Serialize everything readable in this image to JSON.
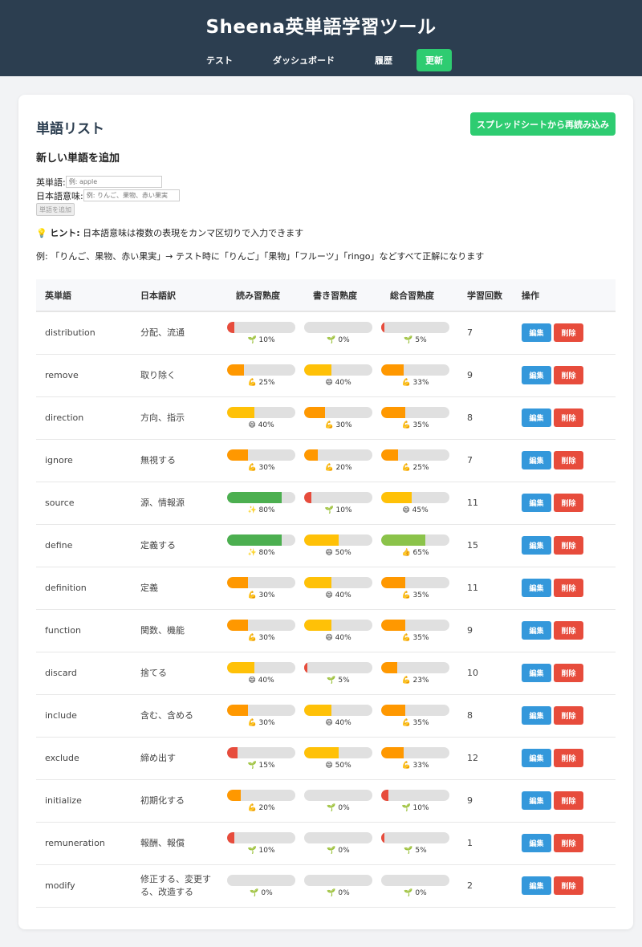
{
  "header": {
    "title": "Sheena英単語学習ツール",
    "nav": [
      {
        "label": "テスト"
      },
      {
        "label": "ダッシュボード"
      },
      {
        "label": "履歴"
      },
      {
        "label": "更新"
      }
    ]
  },
  "main": {
    "title": "単語リスト",
    "reload_label": "スプレッドシートから再読み込み",
    "add_title": "新しい単語を追加",
    "form": {
      "english_label": "英単語:",
      "english_placeholder": "例: apple",
      "japanese_label": "日本語意味:",
      "japanese_placeholder": "例: りんご、果物、赤い果実",
      "submit_label": "単語を追加"
    },
    "hint_icon": "💡",
    "hint_strong": "ヒント:",
    "hint_text": "日本語意味は複数の表現をカンマ区切りで入力できます",
    "example_text": "例: 「りんご、果物、赤い果実」→ テスト時に「りんご」「果物」「フルーツ」「ringo」などすべて正解になります"
  },
  "table": {
    "columns": [
      "英単語",
      "日本語訳",
      "読み習熟度",
      "書き習熟度",
      "総合習熟度",
      "学習回数",
      "操作"
    ],
    "edit_label": "編集",
    "delete_label": "削除",
    "rows": [
      {
        "en": "distribution",
        "ja": "分配、流通",
        "read": 10,
        "write": 0,
        "total": 5,
        "count": "7"
      },
      {
        "en": "remove",
        "ja": "取り除く",
        "read": 25,
        "write": 40,
        "total": 33,
        "count": "9"
      },
      {
        "en": "direction",
        "ja": "方向、指示",
        "read": 40,
        "write": 30,
        "total": 35,
        "count": "8"
      },
      {
        "en": "ignore",
        "ja": "無視する",
        "read": 30,
        "write": 20,
        "total": 25,
        "count": "7"
      },
      {
        "en": "source",
        "ja": "源、情報源",
        "read": 80,
        "write": 10,
        "total": 45,
        "count": "11"
      },
      {
        "en": "define",
        "ja": "定義する",
        "read": 80,
        "write": 50,
        "total": 65,
        "count": "15"
      },
      {
        "en": "definition",
        "ja": "定義",
        "read": 30,
        "write": 40,
        "total": 35,
        "count": "11"
      },
      {
        "en": "function",
        "ja": "関数、機能",
        "read": 30,
        "write": 40,
        "total": 35,
        "count": "9"
      },
      {
        "en": "discard",
        "ja": "捨てる",
        "read": 40,
        "write": 5,
        "total": 23,
        "count": "10"
      },
      {
        "en": "include",
        "ja": "含む、含める",
        "read": 30,
        "write": 40,
        "total": 35,
        "count": "8"
      },
      {
        "en": "exclude",
        "ja": "締め出す",
        "read": 15,
        "write": 50,
        "total": 33,
        "count": "12"
      },
      {
        "en": "initialize",
        "ja": "初期化する",
        "read": 20,
        "write": 0,
        "total": 10,
        "count": "9"
      },
      {
        "en": "remuneration",
        "ja": "報酬、報償",
        "read": 10,
        "write": 0,
        "total": 5,
        "count": "1"
      },
      {
        "en": "modify",
        "ja": "修正する、変更する、改造する",
        "read": 0,
        "write": 0,
        "total": 0,
        "count": "2"
      }
    ]
  },
  "colors": {
    "header_bg": "#2c3e50",
    "accent_green": "#2ecc71",
    "edit_blue": "#3498db",
    "delete_red": "#e74c3c",
    "level_red": "#e74c3c",
    "level_orange": "#ff9800",
    "level_yellow": "#ffc107",
    "level_lightgreen": "#8bc34a",
    "level_green": "#4caf50"
  }
}
